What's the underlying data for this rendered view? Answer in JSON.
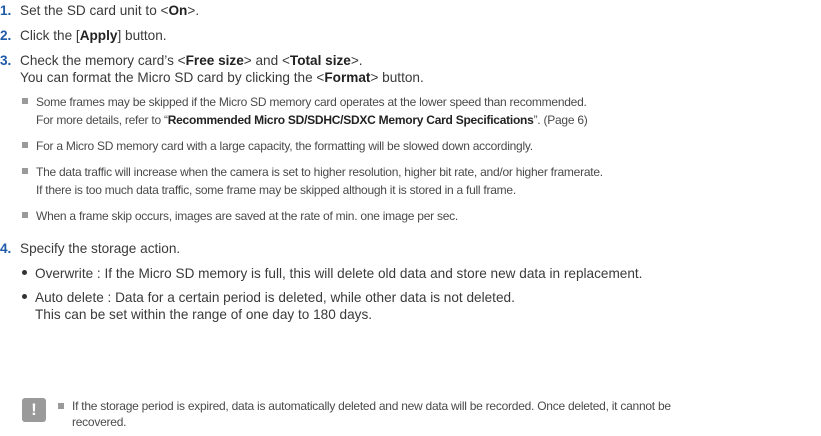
{
  "steps": [
    {
      "num": "1.",
      "pre": "Set the SD card unit to <",
      "b1": "On",
      "post": ">."
    },
    {
      "num": "2.",
      "pre": "Click the [",
      "b1": "Apply",
      "post": "] button."
    },
    {
      "num": "3.",
      "pre": "Check the memory card’s <",
      "b1": "Free size",
      "mid": "> and <",
      "b2": "Total size",
      "post": ">."
    },
    {
      "num": "4.",
      "text": "Specify the storage action."
    }
  ],
  "step3_cont": {
    "pre": "You can format the Micro SD card by clicking the <",
    "b1": "Format",
    "post": "> button."
  },
  "notes": [
    {
      "line1": "Some frames may be skipped if the Micro SD memory card operates at the lower speed than recommended.",
      "line2_pre": "For more details, refer to “",
      "line2_bold": "Recommended Micro SD/SDHC/SDXC Memory Card Specifications",
      "line2_post": "”. (Page 6)"
    },
    {
      "line1": "For a Micro SD memory card with a large capacity, the formatting will be slowed down accordingly."
    },
    {
      "line1": "The data traffic will increase when the camera is set to higher resolution, higher bit rate, and/or higher framerate.",
      "line2": "If there is too much data traffic, some frame may be skipped although it is stored in a full frame."
    },
    {
      "line1": "When a frame skip occurs, images are saved at the rate of min. one image per sec."
    }
  ],
  "bullets": [
    {
      "line1": "Overwrite : If the Micro SD memory is full, this will delete old data and store new data in replacement."
    },
    {
      "line1": "Auto delete : Data for a certain period is deleted, while other data is not deleted.",
      "line2": "This can be set within the range of one day to 180 days."
    }
  ],
  "warning": {
    "icon": "!",
    "line1": "If the storage period is expired, data is automatically deleted and new data will be recorded. Once deleted, it cannot be",
    "line2": "recovered."
  }
}
